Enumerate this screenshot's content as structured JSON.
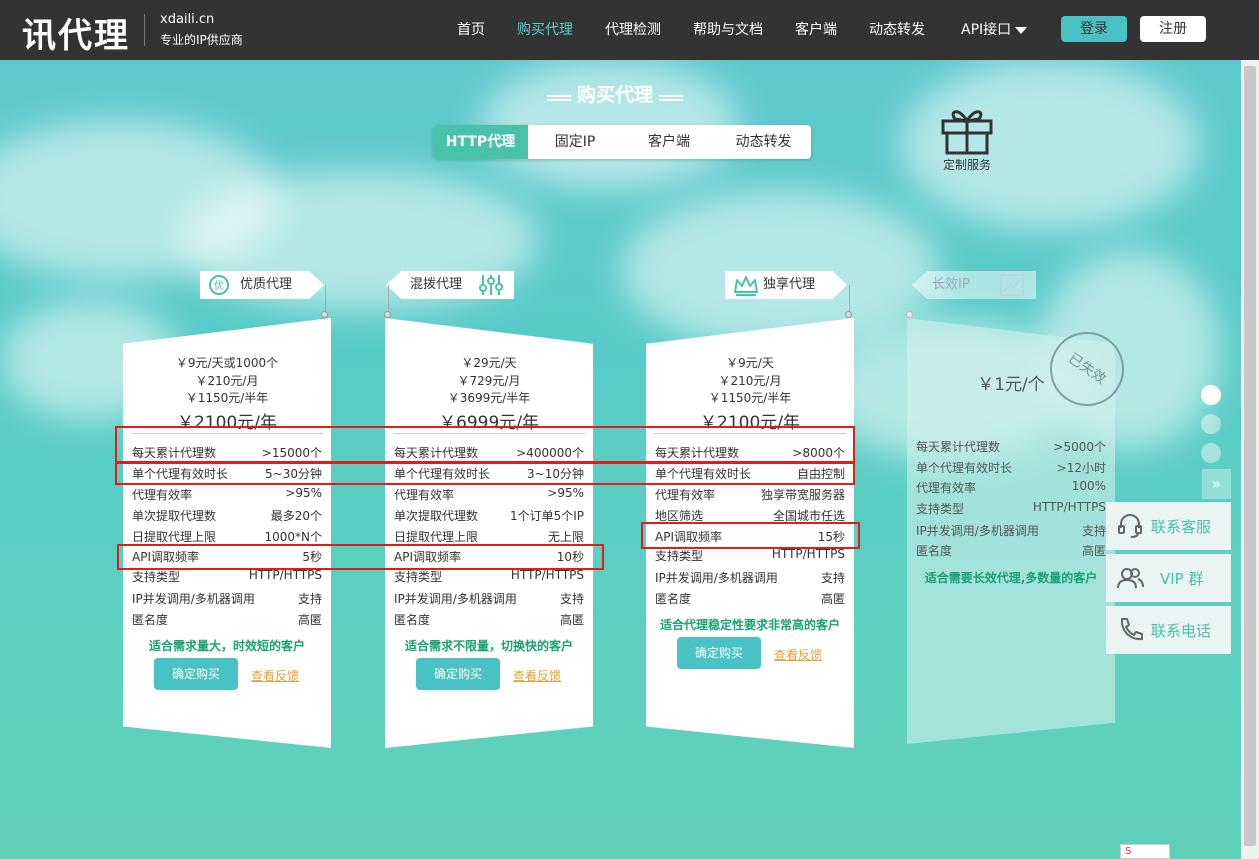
{
  "header": {
    "logo": "讯代理",
    "domain": "xdaili.cn",
    "slogan": "专业的IP供应商",
    "nav": [
      "首页",
      "购买代理",
      "代理检测",
      "帮助与文档",
      "客户端",
      "动态转发",
      "API接口"
    ],
    "login": "登录",
    "register": "注册"
  },
  "page_title": "购买代理",
  "tabs": [
    "HTTP代理",
    "固定IP",
    "客户端",
    "动态转发"
  ],
  "custom_service": "定制服务",
  "cards": [
    {
      "tag": "优质代理",
      "tag_icon": "优",
      "prices": [
        "￥9元/天或1000个",
        "￥210元/月",
        "￥1150元/半年"
      ],
      "price_big": "￥2100元/年",
      "rows": [
        [
          "每天累计代理数",
          ">15000个"
        ],
        [
          "单个代理有效时长",
          "5~30分钟"
        ],
        [
          "代理有效率",
          ">95%"
        ],
        [
          "单次提取代理数",
          "最多20个"
        ],
        [
          "日提取代理上限",
          "1000*N个"
        ],
        [
          "API调取频率",
          "5秒"
        ],
        [
          "支持类型",
          "HTTP/HTTPS"
        ],
        [
          "IP并发调用/多机器调用",
          "支持"
        ],
        [
          "匿名度",
          "高匿"
        ]
      ],
      "suitable": "适合需求量大，时效短的客户",
      "buy": "确定购买",
      "feedback": "查看反馈"
    },
    {
      "tag": "混拨代理",
      "prices": [
        "￥29元/天",
        "￥729元/月",
        "￥3699元/半年"
      ],
      "price_big": "￥6999元/年",
      "rows": [
        [
          "每天累计代理数",
          ">400000个"
        ],
        [
          "单个代理有效时长",
          "3~10分钟"
        ],
        [
          "代理有效率",
          ">95%"
        ],
        [
          "单次提取代理数",
          "1个订单5个IP"
        ],
        [
          "日提取代理上限",
          "无上限"
        ],
        [
          "API调取频率",
          "10秒"
        ],
        [
          "支持类型",
          "HTTP/HTTPS"
        ],
        [
          "IP并发调用/多机器调用",
          "支持"
        ],
        [
          "匿名度",
          "高匿"
        ]
      ],
      "suitable": "适合需求不限量，切换快的客户",
      "buy": "确定购买",
      "feedback": "查看反馈"
    },
    {
      "tag": "独享代理",
      "prices": [
        "￥9元/天",
        "￥210元/月",
        "￥1150元/半年"
      ],
      "price_big": "￥2100元/年",
      "rows": [
        [
          "每天累计代理数",
          ">8000个"
        ],
        [
          "单个代理有效时长",
          "自由控制"
        ],
        [
          "代理有效率",
          "独享带宽服务器"
        ],
        [
          "地区筛选",
          "全国城市任选"
        ],
        [
          "API调取频率",
          "15秒"
        ],
        [
          "支持类型",
          "HTTP/HTTPS"
        ],
        [
          "IP并发调用/多机器调用",
          "支持"
        ],
        [
          "匿名度",
          "高匿"
        ]
      ],
      "suitable": "适合代理稳定性要求非常高的客户",
      "buy": "确定购买",
      "feedback": "查看反馈"
    },
    {
      "tag": "长效IP",
      "price": "￥1元/个",
      "stamp": "已失效",
      "rows": [
        [
          "每天累计代理数",
          ">5000个"
        ],
        [
          "单个代理有效时长",
          ">12小时"
        ],
        [
          "代理有效率",
          "100%"
        ],
        [
          "支持类型",
          "HTTP/HTTPS"
        ],
        [
          "IP并发调用/多机器调用",
          "支持"
        ],
        [
          "匿名度",
          "高匿"
        ]
      ],
      "suitable": "适合需要长效代理,多数量的客户"
    }
  ],
  "side": {
    "service": "联系客服",
    "vip": "VIP 群",
    "phone": "联系电话",
    "more": "»"
  },
  "corner_badge": "S"
}
